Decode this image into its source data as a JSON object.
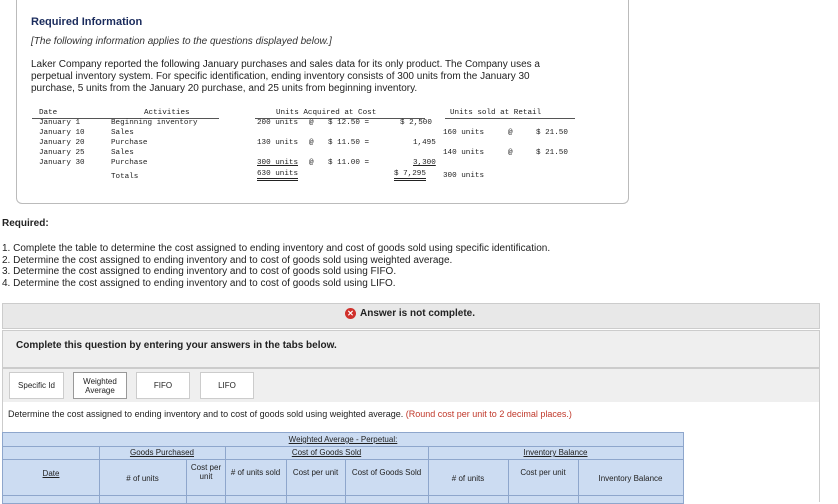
{
  "info": {
    "title": "Required Information",
    "subtitle": "[The following information applies to the questions displayed below.]",
    "paragraph": "Laker Company reported the following January purchases and sales data for its only product. The Company uses a perpetual inventory system. For specific identification, ending inventory consists of 300 units from the January 30 purchase, 5 units from the January 20 purchase, and 25 units from beginning inventory."
  },
  "data_table": {
    "headers": {
      "date": "Date",
      "activities": "Activities",
      "acquired": "Units Acquired at Cost",
      "sold": "Units sold at Retail"
    },
    "rows": [
      {
        "date": "January 1",
        "activity": "Beginning inventory",
        "units": "200 units",
        "at": "@",
        "cost": "$ 12.50 =",
        "total": "$ 2,500",
        "sold_units": "",
        "sold_at": "",
        "retail": ""
      },
      {
        "date": "January 10",
        "activity": "Sales",
        "units": "",
        "at": "",
        "cost": "",
        "total": "",
        "sold_units": "160 units",
        "sold_at": "@",
        "retail": "$ 21.50"
      },
      {
        "date": "January 20",
        "activity": "Purchase",
        "units": "130 units",
        "at": "@",
        "cost": "$ 11.50 =",
        "total": "1,495",
        "sold_units": "",
        "sold_at": "",
        "retail": ""
      },
      {
        "date": "January 25",
        "activity": "Sales",
        "units": "",
        "at": "",
        "cost": "",
        "total": "",
        "sold_units": "140 units",
        "sold_at": "@",
        "retail": "$ 21.50"
      },
      {
        "date": "January 30",
        "activity": "Purchase",
        "units": "300 units",
        "at": "@",
        "cost": "$ 11.00 =",
        "total": "3,300",
        "sold_units": "",
        "sold_at": "",
        "retail": ""
      }
    ],
    "totals": {
      "label": "Totals",
      "units": "630 units",
      "total": "$ 7,295",
      "sold_units": "300 units"
    }
  },
  "required": {
    "label": "Required:",
    "items": [
      "1. Complete the table to determine the cost assigned to ending inventory and cost of goods sold using specific identification.",
      "2. Determine the cost assigned to ending inventory and to cost of goods sold using weighted average.",
      "3. Determine the cost assigned to ending inventory and to cost of goods sold using FIFO.",
      "4. Determine the cost assigned to ending inventory and to cost of goods sold using LIFO."
    ]
  },
  "status": {
    "text": "Answer is not complete.",
    "icon": "x-circle-icon",
    "color": "#d0302b"
  },
  "complete_prompt": "Complete this question by entering your answers in the tabs below.",
  "tabs": [
    {
      "label": "Specific Id",
      "active": false
    },
    {
      "label": "Weighted Average",
      "active": true
    },
    {
      "label": "FIFO",
      "active": false
    },
    {
      "label": "LIFO",
      "active": false
    }
  ],
  "instruction": {
    "main": "Determine the cost assigned to ending inventory and to cost of goods sold using weighted average.",
    "note": "(Round cost per unit to 2 decimal places.)"
  },
  "wa_table": {
    "title": "Weighted Average - Perpetual:",
    "cogs_header": "Cost of Goods Sold",
    "goods_purchased": "Goods Purchased",
    "inventory_balance": "Inventory Balance",
    "date": "Date",
    "gp_units": "# of units",
    "gp_cost": "Cost per unit",
    "cogs_units": "# of units sold",
    "cogs_cost": "Cost per unit",
    "cogs_total": "Cost of Goods Sold",
    "ib_units": "# of units",
    "ib_cost": "Cost per unit",
    "ib_total": "Inventory Balance"
  }
}
